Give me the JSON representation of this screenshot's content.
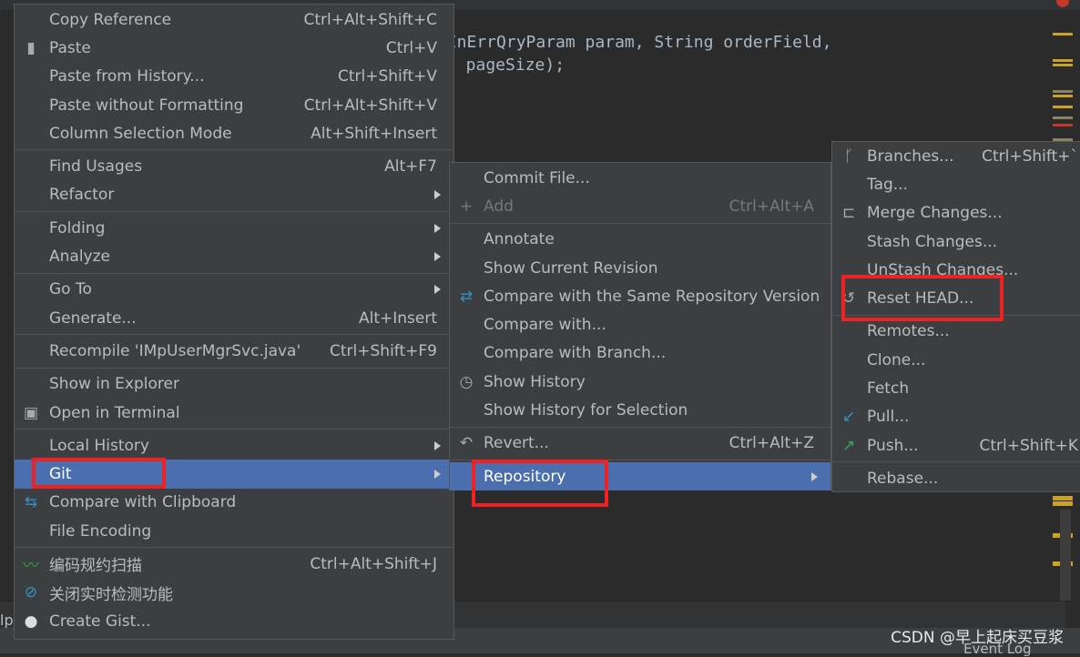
{
  "editor": {
    "code_line1": "gInErrQryParam param, String orderField,",
    "code_line2": ": pageSize);",
    "left_fragment": "lp",
    "scroll_marker_colors": [
      "#c9a227",
      "#c9a227",
      "#c9a227",
      "#8a8466",
      "#c9a227",
      "#c9a227",
      "#8a8466",
      "#c0392b",
      "#8a8466"
    ]
  },
  "colors": {
    "menu_bg": "#3c3f41",
    "highlight": "#4b6eaf",
    "annotation": "#ee2222",
    "editor_bg": "#2b2b2b"
  },
  "menus": {
    "context": [
      {
        "label": "Copy Reference",
        "shortcut": "Ctrl+Alt+Shift+C"
      },
      {
        "label": "Paste",
        "shortcut": "Ctrl+V",
        "icon": "clipboard-icon"
      },
      {
        "label": "Paste from History...",
        "shortcut": "Ctrl+Shift+V"
      },
      {
        "label": "Paste without Formatting",
        "shortcut": "Ctrl+Alt+Shift+V"
      },
      {
        "label": "Column Selection Mode",
        "shortcut": "Alt+Shift+Insert"
      },
      {
        "separator": true
      },
      {
        "label": "Find Usages",
        "shortcut": "Alt+F7"
      },
      {
        "label": "Refactor",
        "submenu": true
      },
      {
        "separator": true
      },
      {
        "label": "Folding",
        "submenu": true
      },
      {
        "label": "Analyze",
        "submenu": true
      },
      {
        "separator": true
      },
      {
        "label": "Go To",
        "submenu": true
      },
      {
        "label": "Generate...",
        "shortcut": "Alt+Insert"
      },
      {
        "separator": true
      },
      {
        "label": "Recompile 'IMpUserMgrSvc.java'",
        "shortcut": "Ctrl+Shift+F9"
      },
      {
        "separator": true
      },
      {
        "label": "Show in Explorer"
      },
      {
        "label": "Open in Terminal",
        "icon": "terminal-icon"
      },
      {
        "separator": true
      },
      {
        "label": "Local History",
        "submenu": true
      },
      {
        "label": "Git",
        "submenu": true,
        "highlighted": true
      },
      {
        "label": "Compare with Clipboard",
        "icon": "compare-clipboard-icon"
      },
      {
        "label": "File Encoding"
      },
      {
        "separator": true
      },
      {
        "label": "编码规约扫描",
        "shortcut": "Ctrl+Alt+Shift+J",
        "icon": "code-scan-icon"
      },
      {
        "label": "关闭实时检测功能",
        "icon": "disable-icon"
      },
      {
        "label": "Create Gist...",
        "icon": "github-icon"
      }
    ],
    "git": [
      {
        "label": "Commit File..."
      },
      {
        "label": "Add",
        "shortcut": "Ctrl+Alt+A",
        "icon": "plus-icon",
        "disabled": true
      },
      {
        "separator": true
      },
      {
        "label": "Annotate"
      },
      {
        "label": "Show Current Revision"
      },
      {
        "label": "Compare with the Same Repository Version",
        "icon": "compare-icon"
      },
      {
        "label": "Compare with..."
      },
      {
        "label": "Compare with Branch..."
      },
      {
        "label": "Show History",
        "icon": "clock-icon"
      },
      {
        "label": "Show History for Selection"
      },
      {
        "separator": true
      },
      {
        "label": "Revert...",
        "shortcut": "Ctrl+Alt+Z",
        "icon": "revert-icon"
      },
      {
        "separator": true
      },
      {
        "label": "Repository",
        "submenu": true,
        "highlighted": true
      }
    ],
    "repository": [
      {
        "label": "Branches...",
        "shortcut": "Ctrl+Shift+`",
        "icon": "branch-icon"
      },
      {
        "label": "Tag..."
      },
      {
        "label": "Merge Changes...",
        "icon": "merge-icon"
      },
      {
        "label": "Stash Changes..."
      },
      {
        "label": "UnStash Changes..."
      },
      {
        "label": "Reset HEAD...",
        "icon": "reset-icon"
      },
      {
        "separator": true
      },
      {
        "label": "Remotes..."
      },
      {
        "label": "Clone..."
      },
      {
        "label": "Fetch"
      },
      {
        "label": "Pull...",
        "icon": "pull-icon"
      },
      {
        "label": "Push...",
        "shortcut": "Ctrl+Shift+K",
        "icon": "push-icon"
      },
      {
        "separator": true
      },
      {
        "label": "Rebase..."
      }
    ]
  },
  "footer": {
    "watermark": "CSDN @早上起床买豆浆",
    "event_log": "Event Log"
  }
}
